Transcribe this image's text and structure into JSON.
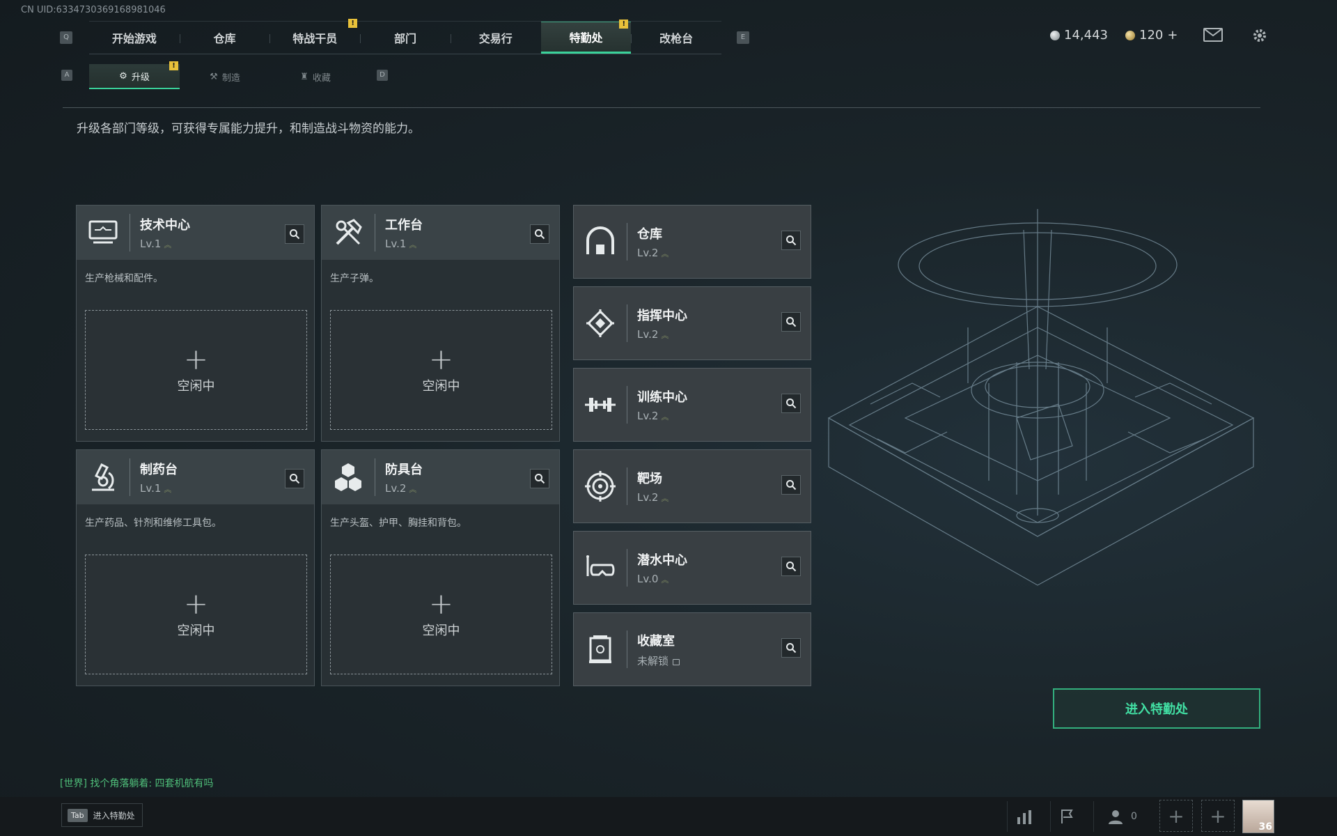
{
  "header": {
    "uid_text": "CN UID:6334730369168981046",
    "prev_key": "Q",
    "next_key": "E",
    "tabs": [
      {
        "label": "开始游戏",
        "active": false,
        "alert": false
      },
      {
        "label": "仓库",
        "active": false,
        "alert": false
      },
      {
        "label": "特战干员",
        "active": false,
        "alert": true
      },
      {
        "label": "部门",
        "active": false,
        "alert": false
      },
      {
        "label": "交易行",
        "active": false,
        "alert": false
      },
      {
        "label": "特勤处",
        "active": true,
        "alert": true
      },
      {
        "label": "改枪台",
        "active": false,
        "alert": false
      }
    ],
    "alert_glyph": "!",
    "currency_silver": "14,443",
    "currency_gold": "120",
    "currency_add": "+",
    "mail_icon": "mail-icon",
    "settings_icon": "gear-icon"
  },
  "subnav": {
    "prev_key": "A",
    "next_key": "D",
    "tabs": [
      {
        "label": "升级",
        "active": true,
        "alert": true
      },
      {
        "label": "制造",
        "active": false,
        "alert": false
      },
      {
        "label": "收藏",
        "active": false,
        "alert": false
      }
    ]
  },
  "description": "升级各部门等级，可获得专属能力提升，和制造战斗物资的能力。",
  "production_cards": [
    {
      "name": "技术中心",
      "level": "Lv.1",
      "desc": "生产枪械和配件。",
      "plus": "+",
      "status": "空闲中",
      "icon": "computer-icon"
    },
    {
      "name": "工作台",
      "level": "Lv.1",
      "desc": "生产子弹。",
      "plus": "+",
      "status": "空闲中",
      "icon": "tools-icon"
    },
    {
      "name": "制药台",
      "level": "Lv.1",
      "desc": "生产药品、针剂和维修工具包。",
      "plus": "+",
      "status": "空闲中",
      "icon": "microscope-icon"
    },
    {
      "name": "防具台",
      "level": "Lv.2",
      "desc": "生产头盔、护甲、胸挂和背包。",
      "plus": "+",
      "status": "空闲中",
      "icon": "cubes-icon"
    }
  ],
  "facilities": [
    {
      "name": "仓库",
      "level": "Lv.2",
      "icon": "warehouse-icon",
      "locked": false
    },
    {
      "name": "指挥中心",
      "level": "Lv.2",
      "icon": "command-icon",
      "locked": false
    },
    {
      "name": "训练中心",
      "level": "Lv.2",
      "icon": "dumbbell-icon",
      "locked": false
    },
    {
      "name": "靶场",
      "level": "Lv.2",
      "icon": "target-icon",
      "locked": false
    },
    {
      "name": "潜水中心",
      "level": "Lv.0",
      "icon": "diving-mask-icon",
      "locked": false
    },
    {
      "name": "收藏室",
      "level": "未解锁",
      "icon": "display-case-icon",
      "locked": true
    }
  ],
  "enter_button": "进入特勤处",
  "chat": {
    "channel": "[世界]",
    "message": "找个角落躺着: 四套机航有吗"
  },
  "bottom": {
    "tab_key": "Tab",
    "tab_label": "进入特勤处",
    "friends_count": "0",
    "avatar_level": "36"
  },
  "colors": {
    "accent": "#3ad29a",
    "alert": "#e8c13a",
    "card_bg": "#283034"
  }
}
